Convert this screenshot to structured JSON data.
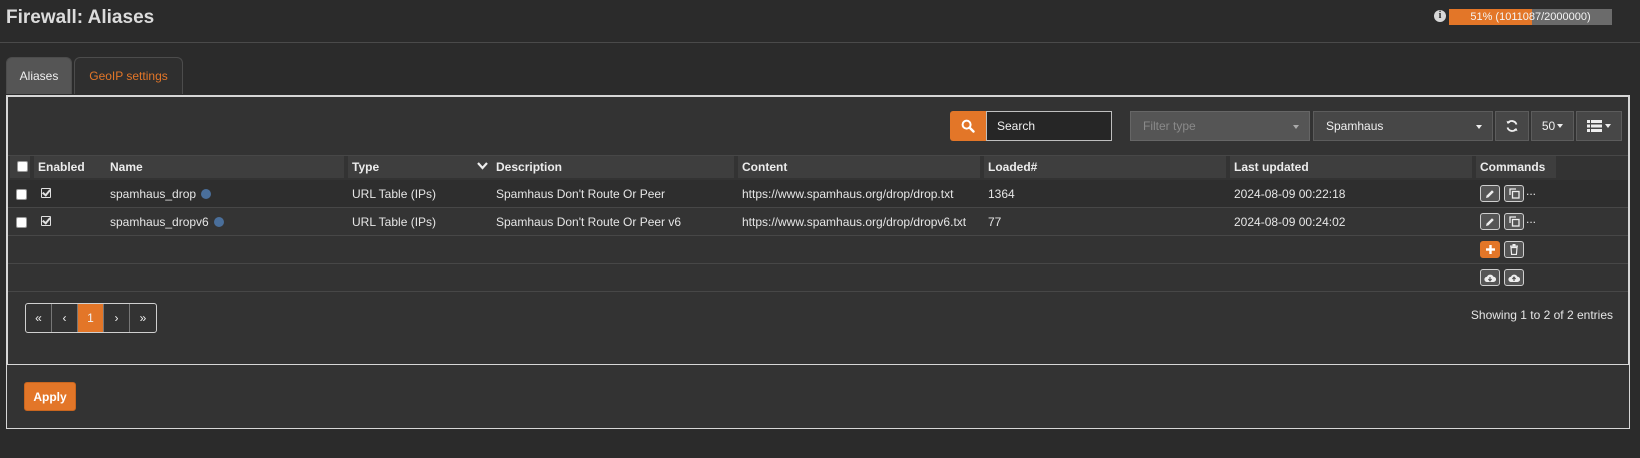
{
  "header": {
    "title": "Firewall: Aliases",
    "progress_text": "51% (1011087/2000000)",
    "progress_fraction": 0.51
  },
  "tabs": [
    {
      "label": "Aliases",
      "active": true
    },
    {
      "label": "GeoIP settings",
      "active": false
    }
  ],
  "toolbar": {
    "search_placeholder": "Search",
    "filter_type_placeholder": "Filter type",
    "category_selected": "Spamhaus",
    "rows_per_page": "50"
  },
  "table": {
    "columns": [
      "Enabled",
      "Name",
      "Type",
      "Description",
      "Content",
      "Loaded#",
      "Last updated",
      "Commands"
    ],
    "rows": [
      {
        "enabled": true,
        "name": "spamhaus_drop",
        "type": "URL Table (IPs)",
        "description": "Spamhaus Don't Route Or Peer",
        "content": "https://www.spamhaus.org/drop/drop.txt",
        "loaded": "1364",
        "last_updated": "2024-08-09 00:22:18"
      },
      {
        "enabled": true,
        "name": "spamhaus_dropv6",
        "type": "URL Table (IPs)",
        "description": "Spamhaus Don't Route Or Peer v6",
        "content": "https://www.spamhaus.org/drop/dropv6.txt",
        "loaded": "77",
        "last_updated": "2024-08-09 00:24:02"
      }
    ],
    "more_commands": "..."
  },
  "pagination": {
    "first": "«",
    "prev": "‹",
    "current": "1",
    "next": "›",
    "last": "»",
    "showing_text": "Showing 1 to 2 of 2 entries"
  },
  "apply_label": "Apply",
  "colors": {
    "accent": "#e37628",
    "background": "#2b2b2b",
    "panel": "#333333",
    "status_dot": "#4a6f9b"
  },
  "icons": {
    "info": "info-icon",
    "search": "search-icon",
    "refresh": "refresh-icon",
    "columns": "list-icon",
    "edit": "pencil-icon",
    "copy": "copy-icon",
    "add": "plus-icon",
    "delete": "trash-icon",
    "download": "cloud-download-icon",
    "upload": "cloud-upload-icon"
  }
}
